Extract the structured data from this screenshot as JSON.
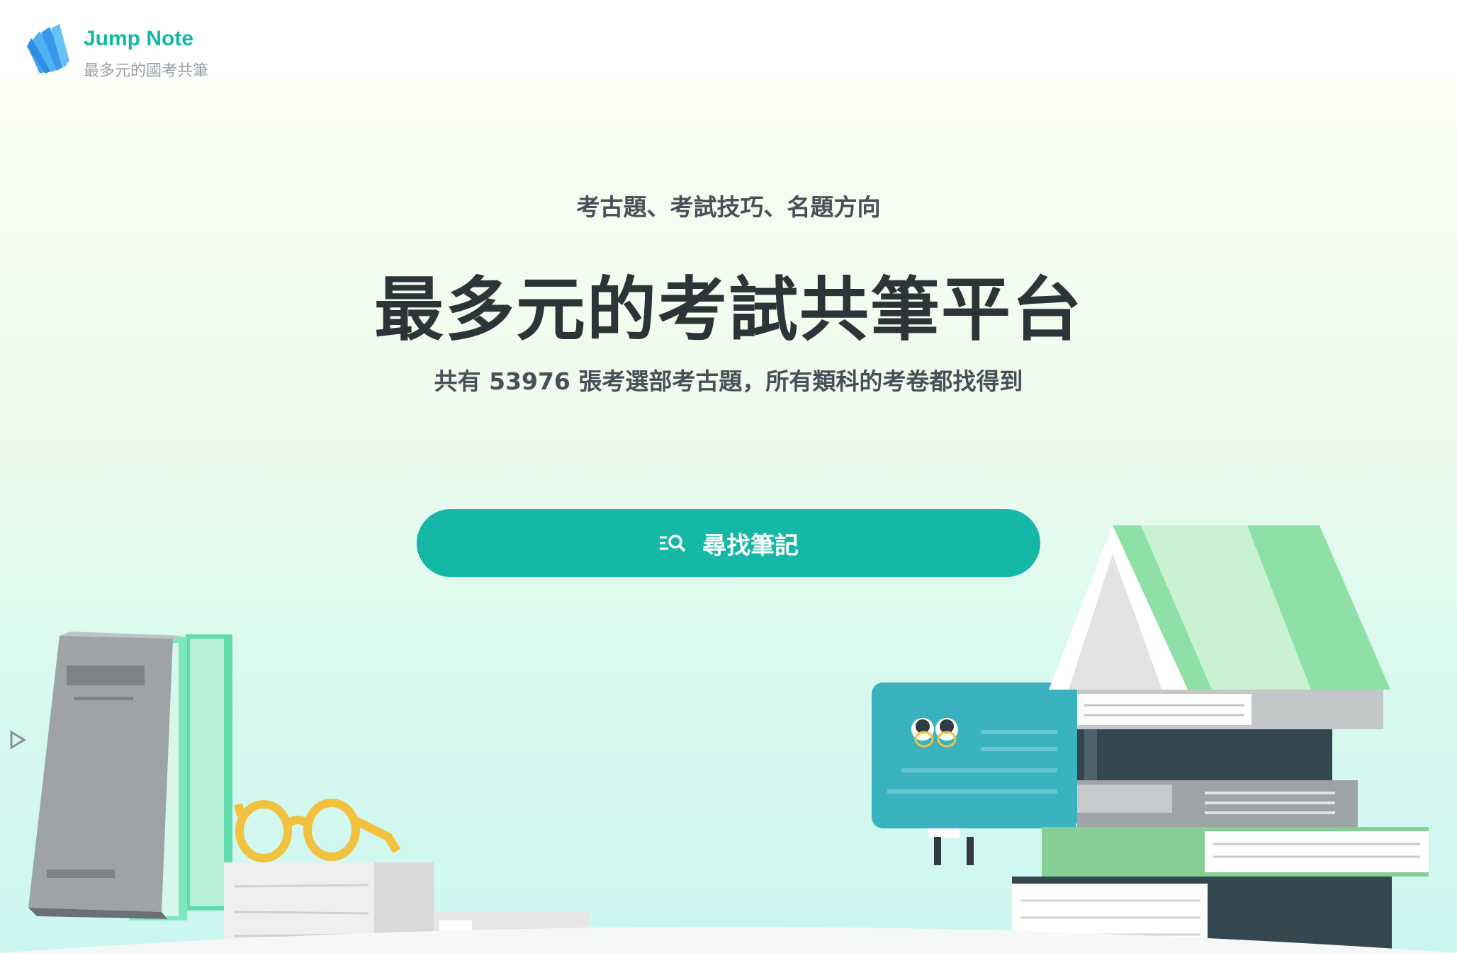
{
  "brand": {
    "name": "Jump Note",
    "tagline": "最多元的國考共筆",
    "logo_icon": "book-fan-logo-icon",
    "color": "#15b8a6"
  },
  "hero": {
    "subtitle": "考古題、考試技巧、名題方向",
    "headline": "最多元的考試共筆平台",
    "stats": "共有 53976 張考選部考古題，所有類科的考卷都找得到",
    "search_button": {
      "label": "尋找筆記",
      "icon": "search-list-icon",
      "color": "#15b8a6"
    }
  },
  "side_widget": {
    "icon": "play-triangle-icon"
  },
  "illustrations": [
    "book-stack-left-illustration",
    "eyeglasses-illustration",
    "paper-stack-illustration",
    "speech-bubble-character-illustration",
    "book-stack-right-illustration"
  ]
}
